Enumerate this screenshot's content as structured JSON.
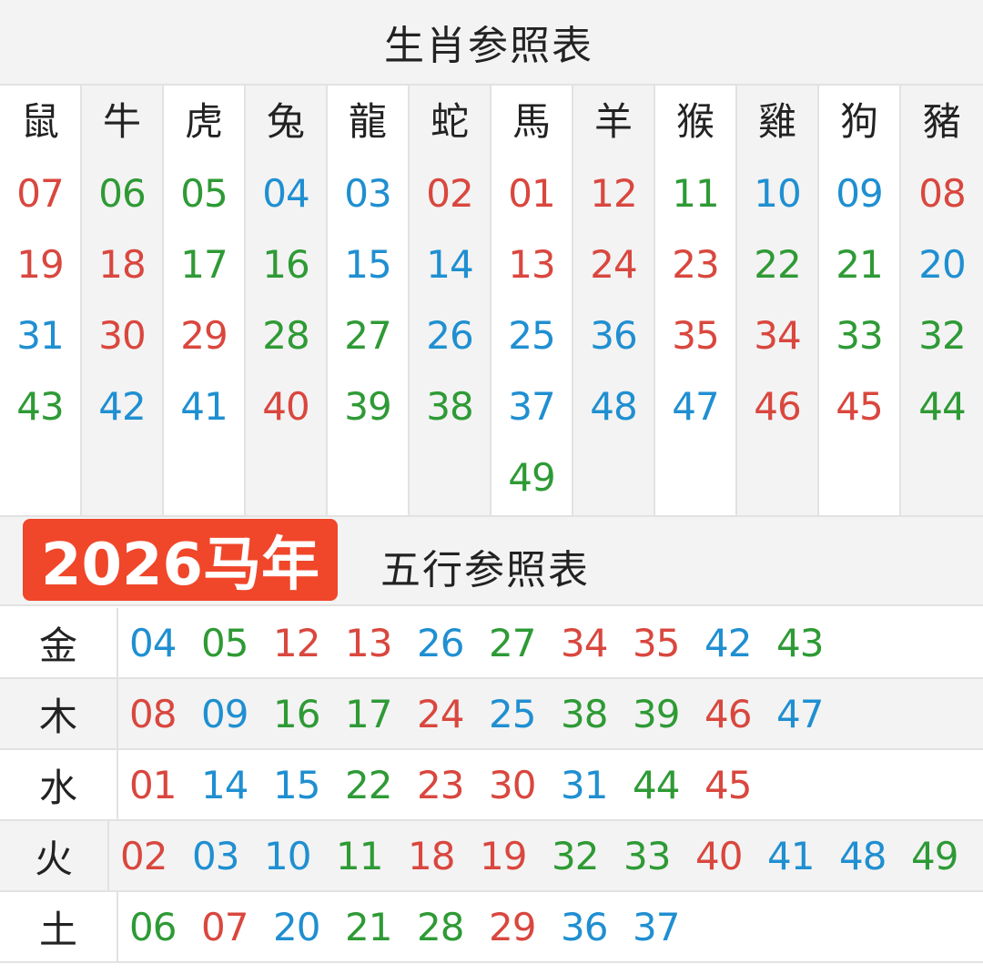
{
  "zodiac_title": "生肖参照表",
  "zodiac": [
    {
      "name": "鼠",
      "numbers": [
        {
          "n": "07",
          "c": "red"
        },
        {
          "n": "19",
          "c": "red"
        },
        {
          "n": "31",
          "c": "blue"
        },
        {
          "n": "43",
          "c": "green"
        }
      ]
    },
    {
      "name": "牛",
      "numbers": [
        {
          "n": "06",
          "c": "green"
        },
        {
          "n": "18",
          "c": "red"
        },
        {
          "n": "30",
          "c": "red"
        },
        {
          "n": "42",
          "c": "blue"
        }
      ]
    },
    {
      "name": "虎",
      "numbers": [
        {
          "n": "05",
          "c": "green"
        },
        {
          "n": "17",
          "c": "green"
        },
        {
          "n": "29",
          "c": "red"
        },
        {
          "n": "41",
          "c": "blue"
        }
      ]
    },
    {
      "name": "兔",
      "numbers": [
        {
          "n": "04",
          "c": "blue"
        },
        {
          "n": "16",
          "c": "green"
        },
        {
          "n": "28",
          "c": "green"
        },
        {
          "n": "40",
          "c": "red"
        }
      ]
    },
    {
      "name": "龍",
      "numbers": [
        {
          "n": "03",
          "c": "blue"
        },
        {
          "n": "15",
          "c": "blue"
        },
        {
          "n": "27",
          "c": "green"
        },
        {
          "n": "39",
          "c": "green"
        }
      ]
    },
    {
      "name": "蛇",
      "numbers": [
        {
          "n": "02",
          "c": "red"
        },
        {
          "n": "14",
          "c": "blue"
        },
        {
          "n": "26",
          "c": "blue"
        },
        {
          "n": "38",
          "c": "green"
        }
      ]
    },
    {
      "name": "馬",
      "numbers": [
        {
          "n": "01",
          "c": "red"
        },
        {
          "n": "13",
          "c": "red"
        },
        {
          "n": "25",
          "c": "blue"
        },
        {
          "n": "37",
          "c": "blue"
        },
        {
          "n": "49",
          "c": "green"
        }
      ]
    },
    {
      "name": "羊",
      "numbers": [
        {
          "n": "12",
          "c": "red"
        },
        {
          "n": "24",
          "c": "red"
        },
        {
          "n": "36",
          "c": "blue"
        },
        {
          "n": "48",
          "c": "blue"
        }
      ]
    },
    {
      "name": "猴",
      "numbers": [
        {
          "n": "11",
          "c": "green"
        },
        {
          "n": "23",
          "c": "red"
        },
        {
          "n": "35",
          "c": "red"
        },
        {
          "n": "47",
          "c": "blue"
        }
      ]
    },
    {
      "name": "雞",
      "numbers": [
        {
          "n": "10",
          "c": "blue"
        },
        {
          "n": "22",
          "c": "green"
        },
        {
          "n": "34",
          "c": "red"
        },
        {
          "n": "46",
          "c": "red"
        }
      ]
    },
    {
      "name": "狗",
      "numbers": [
        {
          "n": "09",
          "c": "blue"
        },
        {
          "n": "21",
          "c": "green"
        },
        {
          "n": "33",
          "c": "green"
        },
        {
          "n": "45",
          "c": "red"
        }
      ]
    },
    {
      "name": "豬",
      "numbers": [
        {
          "n": "08",
          "c": "red"
        },
        {
          "n": "20",
          "c": "blue"
        },
        {
          "n": "32",
          "c": "green"
        },
        {
          "n": "44",
          "c": "green"
        }
      ]
    }
  ],
  "year_badge": "2026马年",
  "wuxing_title": "五行参照表",
  "wuxing": [
    {
      "label": "金",
      "numbers": [
        {
          "n": "04",
          "c": "blue"
        },
        {
          "n": "05",
          "c": "green"
        },
        {
          "n": "12",
          "c": "red"
        },
        {
          "n": "13",
          "c": "red"
        },
        {
          "n": "26",
          "c": "blue"
        },
        {
          "n": "27",
          "c": "green"
        },
        {
          "n": "34",
          "c": "red"
        },
        {
          "n": "35",
          "c": "red"
        },
        {
          "n": "42",
          "c": "blue"
        },
        {
          "n": "43",
          "c": "green"
        }
      ]
    },
    {
      "label": "木",
      "numbers": [
        {
          "n": "08",
          "c": "red"
        },
        {
          "n": "09",
          "c": "blue"
        },
        {
          "n": "16",
          "c": "green"
        },
        {
          "n": "17",
          "c": "green"
        },
        {
          "n": "24",
          "c": "red"
        },
        {
          "n": "25",
          "c": "blue"
        },
        {
          "n": "38",
          "c": "green"
        },
        {
          "n": "39",
          "c": "green"
        },
        {
          "n": "46",
          "c": "red"
        },
        {
          "n": "47",
          "c": "blue"
        }
      ]
    },
    {
      "label": "水",
      "numbers": [
        {
          "n": "01",
          "c": "red"
        },
        {
          "n": "14",
          "c": "blue"
        },
        {
          "n": "15",
          "c": "blue"
        },
        {
          "n": "22",
          "c": "green"
        },
        {
          "n": "23",
          "c": "red"
        },
        {
          "n": "30",
          "c": "red"
        },
        {
          "n": "31",
          "c": "blue"
        },
        {
          "n": "44",
          "c": "green"
        },
        {
          "n": "45",
          "c": "red"
        }
      ]
    },
    {
      "label": "火",
      "numbers": [
        {
          "n": "02",
          "c": "red"
        },
        {
          "n": "03",
          "c": "blue"
        },
        {
          "n": "10",
          "c": "blue"
        },
        {
          "n": "11",
          "c": "green"
        },
        {
          "n": "18",
          "c": "red"
        },
        {
          "n": "19",
          "c": "red"
        },
        {
          "n": "32",
          "c": "green"
        },
        {
          "n": "33",
          "c": "green"
        },
        {
          "n": "40",
          "c": "red"
        },
        {
          "n": "41",
          "c": "blue"
        },
        {
          "n": "48",
          "c": "blue"
        },
        {
          "n": "49",
          "c": "green"
        }
      ]
    },
    {
      "label": "土",
      "numbers": [
        {
          "n": "06",
          "c": "green"
        },
        {
          "n": "07",
          "c": "red"
        },
        {
          "n": "20",
          "c": "blue"
        },
        {
          "n": "21",
          "c": "green"
        },
        {
          "n": "28",
          "c": "green"
        },
        {
          "n": "29",
          "c": "red"
        },
        {
          "n": "36",
          "c": "blue"
        },
        {
          "n": "37",
          "c": "blue"
        }
      ]
    }
  ],
  "colors": {
    "red": "#d9473e",
    "green": "#2e9a35",
    "blue": "#1f8fd1",
    "badge": "#f0462a"
  }
}
